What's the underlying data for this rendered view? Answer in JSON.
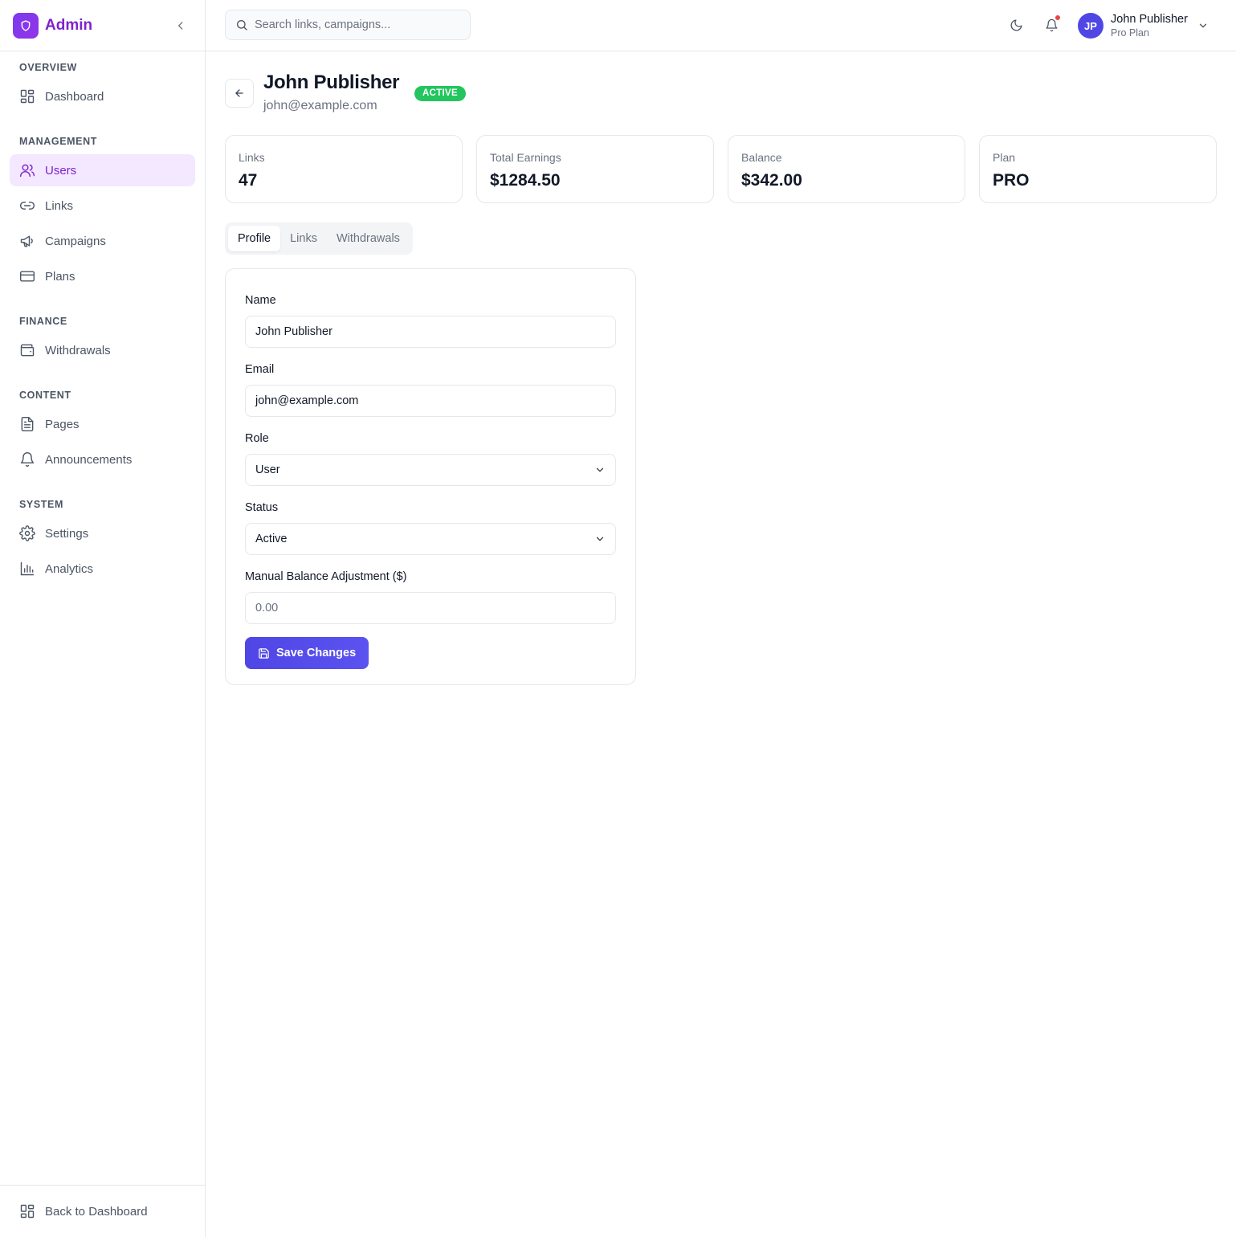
{
  "brand": {
    "name": "Admin",
    "logo_icon": "shield-icon"
  },
  "sidebar": {
    "sections": [
      {
        "title": "OVERVIEW",
        "items": [
          {
            "label": "Dashboard",
            "icon": "dashboard-icon"
          }
        ]
      },
      {
        "title": "MANAGEMENT",
        "items": [
          {
            "label": "Users",
            "icon": "users-icon",
            "active": true
          },
          {
            "label": "Links",
            "icon": "link-icon"
          },
          {
            "label": "Campaigns",
            "icon": "megaphone-icon"
          },
          {
            "label": "Plans",
            "icon": "credit-card-icon"
          }
        ]
      },
      {
        "title": "FINANCE",
        "items": [
          {
            "label": "Withdrawals",
            "icon": "wallet-icon"
          }
        ]
      },
      {
        "title": "CONTENT",
        "items": [
          {
            "label": "Pages",
            "icon": "file-icon"
          },
          {
            "label": "Announcements",
            "icon": "bell-icon"
          }
        ]
      },
      {
        "title": "SYSTEM",
        "items": [
          {
            "label": "Settings",
            "icon": "gear-icon"
          },
          {
            "label": "Analytics",
            "icon": "bar-chart-icon"
          }
        ]
      }
    ],
    "footer_link": "Back to Dashboard"
  },
  "header": {
    "search_placeholder": "Search links, campaigns...",
    "user": {
      "initials": "JP",
      "name": "John Publisher",
      "plan": "Pro Plan"
    },
    "has_notification": true
  },
  "page": {
    "title": "John Publisher",
    "email": "john@example.com",
    "status": "ACTIVE"
  },
  "stats": [
    {
      "label": "Links",
      "value": "47"
    },
    {
      "label": "Total Earnings",
      "value": "$1284.50"
    },
    {
      "label": "Balance",
      "value": "$342.00"
    },
    {
      "label": "Plan",
      "value": "PRO"
    }
  ],
  "tabs": [
    {
      "label": "Profile",
      "active": true
    },
    {
      "label": "Links"
    },
    {
      "label": "Withdrawals"
    }
  ],
  "form": {
    "name_label": "Name",
    "name_value": "John Publisher",
    "email_label": "Email",
    "email_value": "john@example.com",
    "role_label": "Role",
    "role_value": "User",
    "status_label": "Status",
    "status_value": "Active",
    "balance_label": "Manual Balance Adjustment ($)",
    "balance_placeholder": "0.00",
    "save_label": "Save Changes"
  },
  "colors": {
    "accent": "#7e22ce",
    "primary_button": "#4f46e5",
    "active_badge": "#22c55e",
    "notification_dot": "#ef4444"
  }
}
